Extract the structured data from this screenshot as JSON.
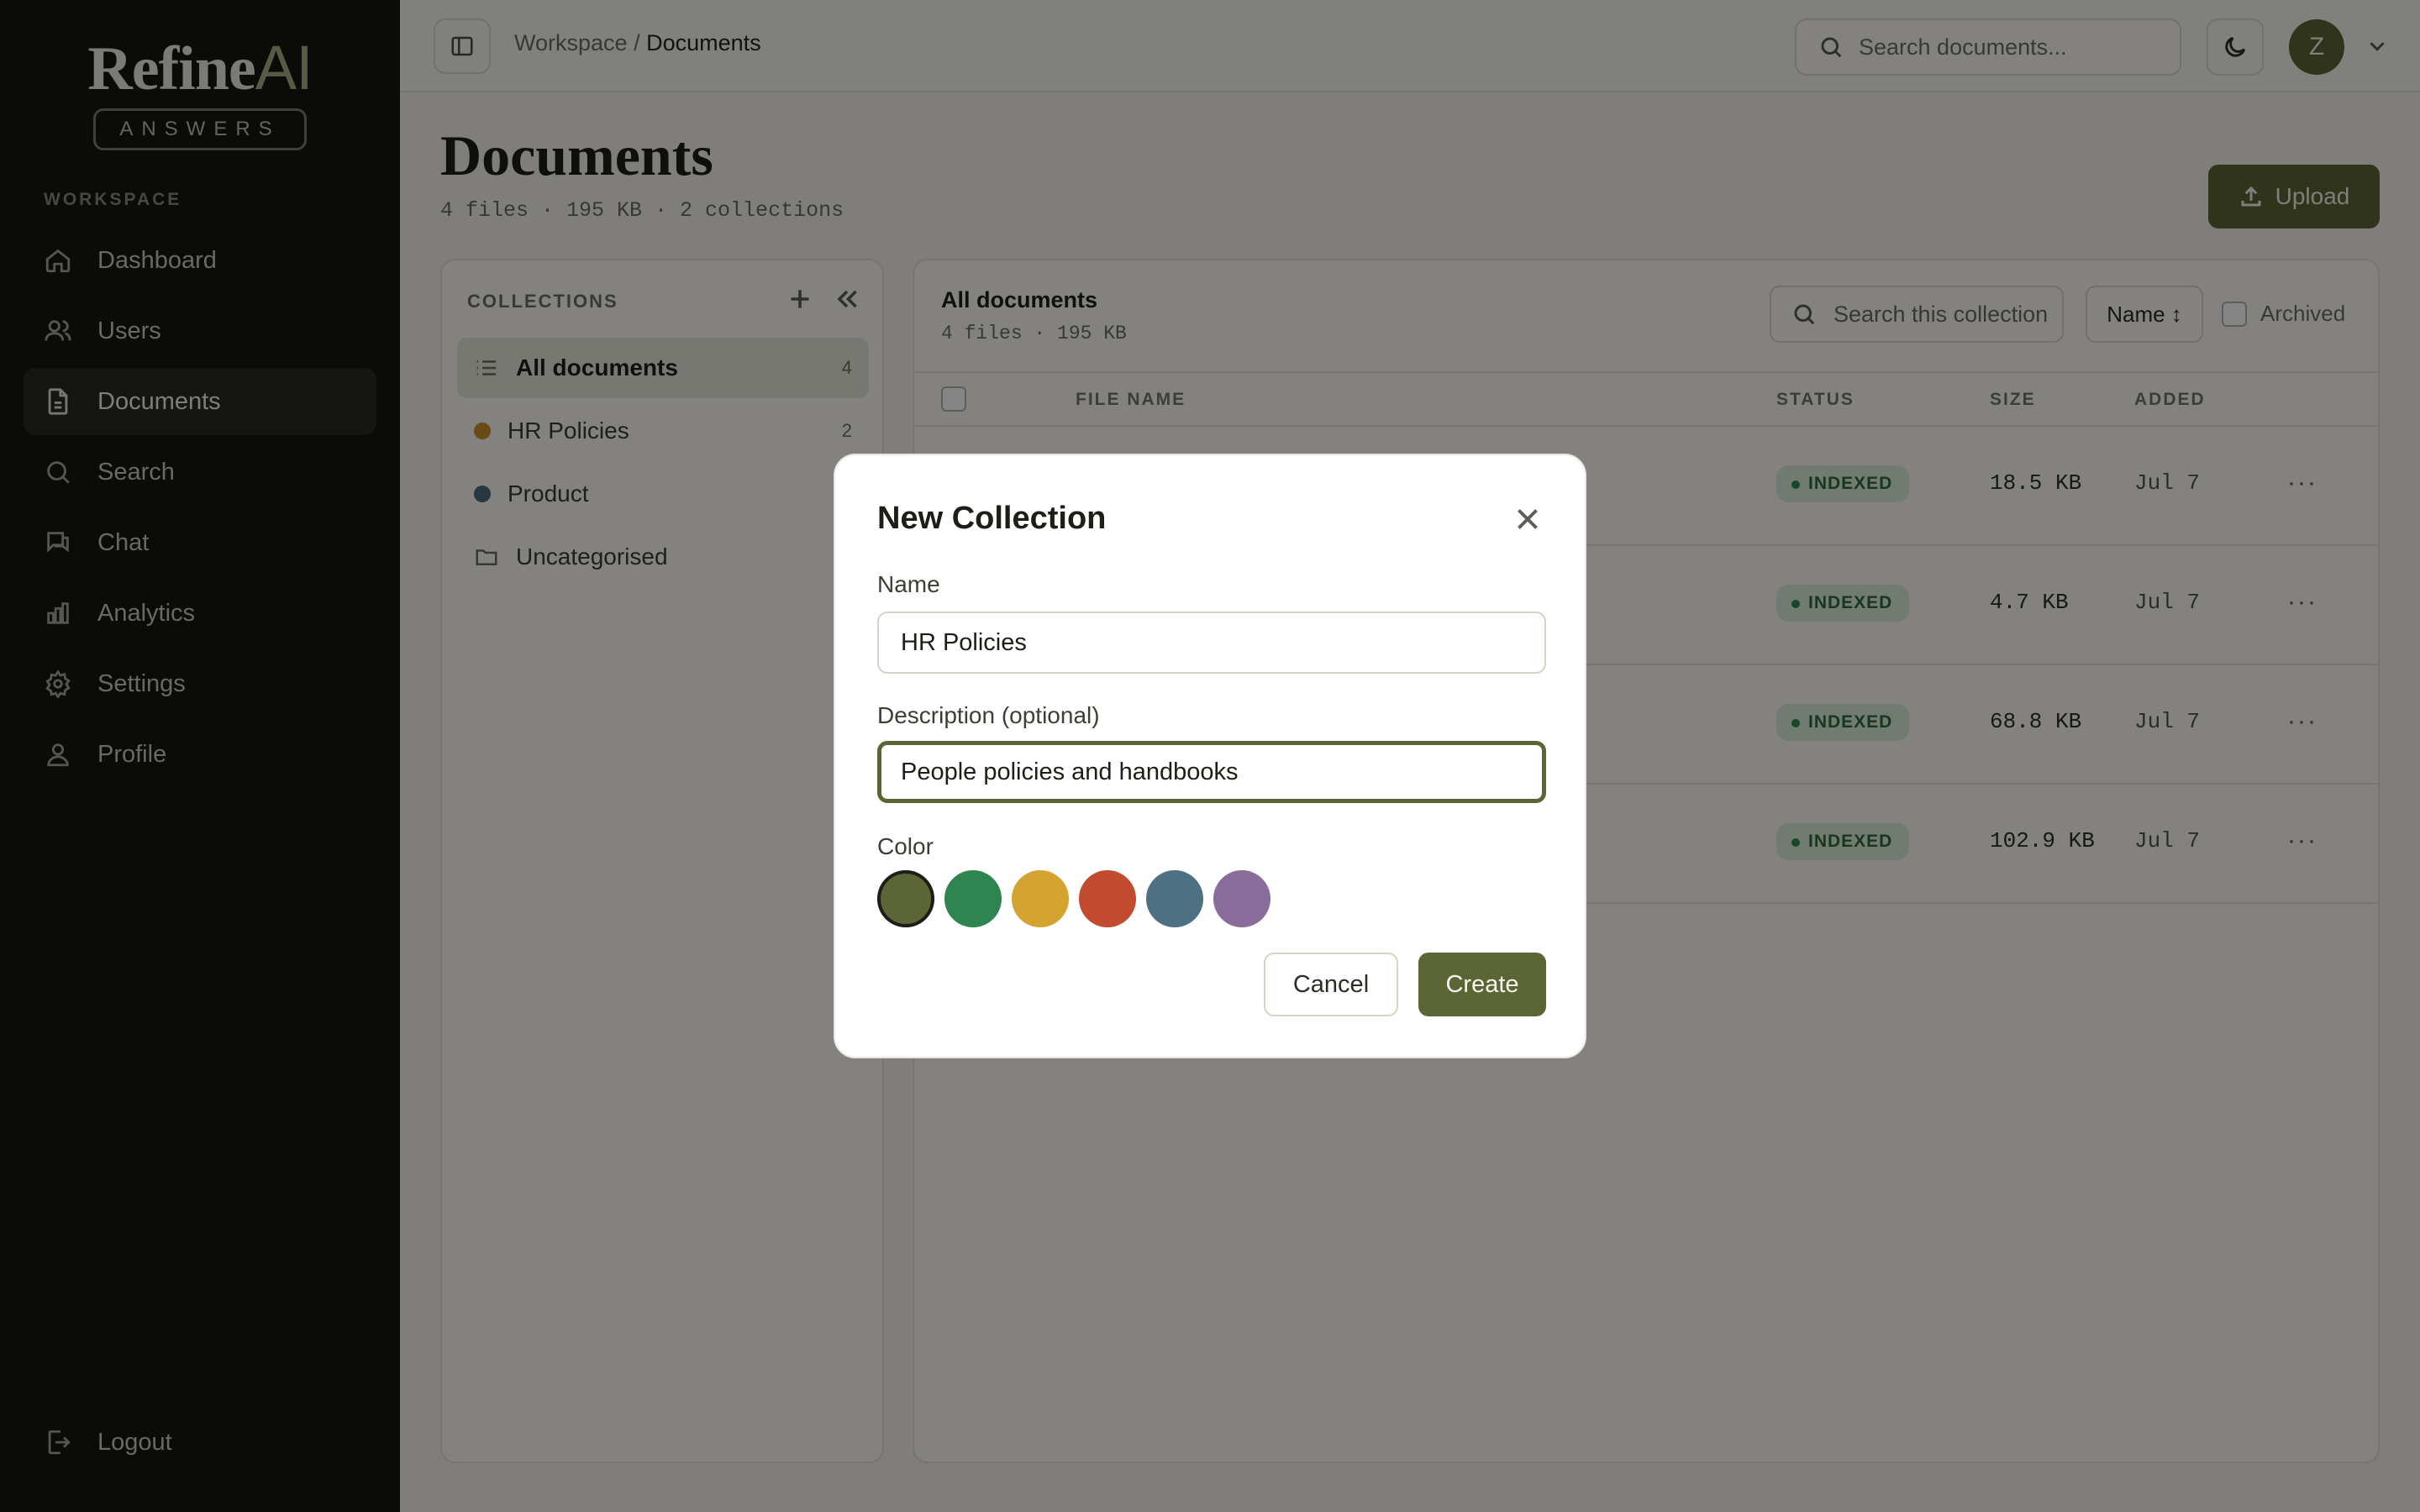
{
  "brand": {
    "name": "Refine",
    "name_accent": "AI",
    "tagline": "ANSWERS"
  },
  "sidebar": {
    "section_label": "WORKSPACE",
    "items": [
      {
        "label": "Dashboard",
        "icon": "home-icon"
      },
      {
        "label": "Users",
        "icon": "users-icon"
      },
      {
        "label": "Documents",
        "icon": "document-icon",
        "active": true
      },
      {
        "label": "Search",
        "icon": "search-icon"
      },
      {
        "label": "Chat",
        "icon": "chat-icon"
      },
      {
        "label": "Analytics",
        "icon": "bar-chart-icon"
      },
      {
        "label": "Settings",
        "icon": "gear-icon"
      },
      {
        "label": "Profile",
        "icon": "user-icon"
      }
    ],
    "logout_label": "Logout"
  },
  "topbar": {
    "breadcrumb_root": "Workspace",
    "breadcrumb_sep": "/",
    "breadcrumb_current": "Documents",
    "search_placeholder": "Search documents...",
    "avatar_initial": "Z"
  },
  "page": {
    "title": "Documents",
    "meta": "4 files · 195 KB · 2 collections",
    "upload_label": "Upload"
  },
  "collections": {
    "header": "COLLECTIONS",
    "items": [
      {
        "label": "All documents",
        "count": "4",
        "active": true
      },
      {
        "label": "HR Policies",
        "count": "2",
        "color": "#c8902a"
      },
      {
        "label": "Product",
        "count": "",
        "color": "#4b6b7c"
      },
      {
        "label": "Uncategorised",
        "count": ""
      }
    ]
  },
  "docs": {
    "title": "All documents",
    "meta": "4 files · 195 KB",
    "search_placeholder": "Search this collection",
    "sort_label": "Name ↕",
    "archived_label": "Archived",
    "columns": {
      "name": "FILE NAME",
      "status": "STATUS",
      "size": "SIZE",
      "added": "ADDED"
    },
    "rows": [
      {
        "status": "INDEXED",
        "size": "18.5 KB",
        "added": "Jul 7",
        "more": "···"
      },
      {
        "status": "INDEXED",
        "size": "4.7 KB",
        "added": "Jul 7",
        "more": "···"
      },
      {
        "status": "INDEXED",
        "size": "68.8 KB",
        "added": "Jul 7",
        "more": "···"
      },
      {
        "status": "INDEXED",
        "size": "102.9 KB",
        "added": "Jul 7",
        "more": "···"
      }
    ]
  },
  "modal": {
    "title": "New Collection",
    "name_label": "Name",
    "name_value": "HR Policies",
    "desc_label": "Description (optional)",
    "desc_value": "People policies and handbooks",
    "color_label": "Color",
    "colors": [
      "#5b6535",
      "#2e8550",
      "#d4a22f",
      "#c24a2e",
      "#4d7082",
      "#8a6c9b"
    ],
    "selected_color": "#5b6535",
    "cancel_label": "Cancel",
    "create_label": "Create"
  }
}
